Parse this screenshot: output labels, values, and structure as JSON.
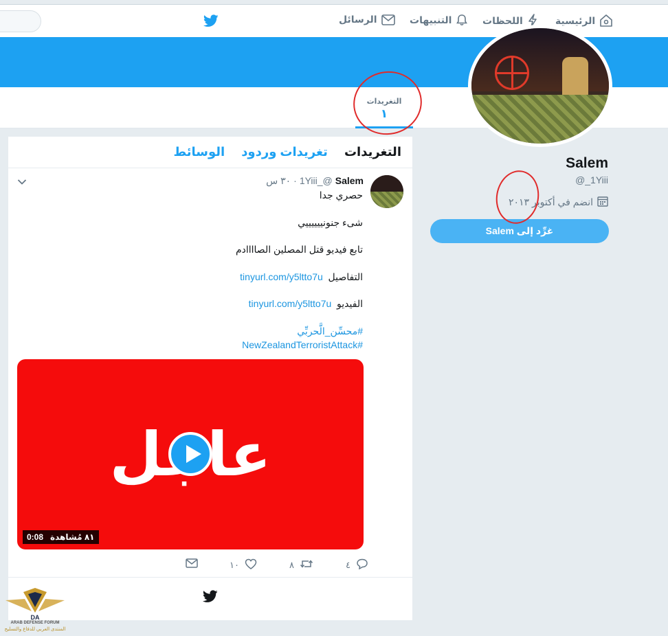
{
  "nav": {
    "home": "الرئيسية",
    "moments": "اللحظات",
    "notifications": "التنبيهات",
    "messages": "الرسائل"
  },
  "profile_nav": {
    "tweets_label": "التغريدات",
    "tweets_count": "١"
  },
  "profile": {
    "name": "Salem",
    "handle": "@_1Yiii",
    "joined": "انضم في أكتوبر ٢٠١٣",
    "tweet_to_button": "غرِّد إلى Salem"
  },
  "timeline": {
    "tabs": [
      "التغريدات",
      "تغريدات وردود",
      "الوسائط"
    ]
  },
  "tweet": {
    "name": "Salem",
    "handle": "@_1Yiii",
    "time": "٣٠ س",
    "lines": {
      "l1": "حصري جدا",
      "l2": "شىء جنونييييييي",
      "l3": "تابع فيديو قتل المصلين الصاااادم",
      "l4_label": "التفاصيل",
      "l4_link": "tinyurl.com/y5ltto7u",
      "l5_label": "الفيديو",
      "l5_link": "tinyurl.com/y5ltto7u",
      "hashtag1": "#محسِّن_الَّحربِّي",
      "hashtag2": "#NewZealandTerroristAttack"
    },
    "media": {
      "word": "عاجل",
      "duration": "0:08",
      "views": "٨١ مُشاهدة"
    },
    "actions": {
      "replies": "٤",
      "retweets": "٨",
      "likes": "١٠"
    }
  },
  "watermark": {
    "line1": "ARAB DEFENSE FORUM",
    "line2": "المنتدى العربي للدفاع والتسليح"
  },
  "colors": {
    "brand": "#1da1f2",
    "annotation": "#e02b2b"
  }
}
